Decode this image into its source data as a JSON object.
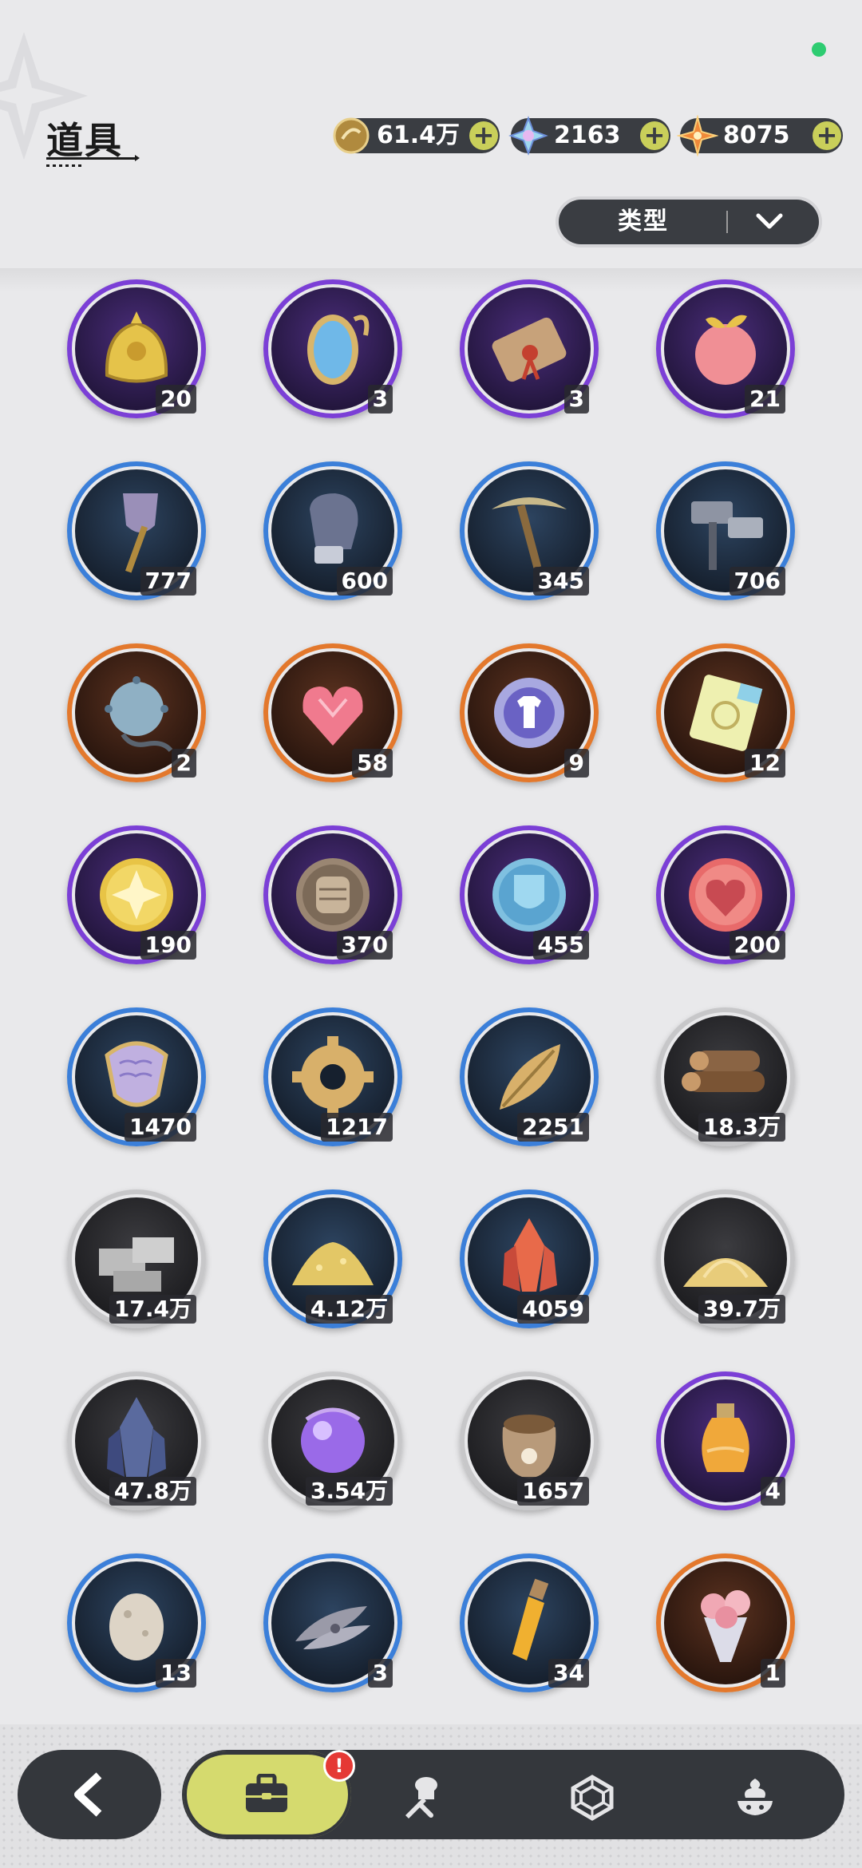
{
  "header": {
    "title": "道具"
  },
  "currencies": [
    {
      "name": "mora",
      "icon": "gold-coin-icon",
      "value": "61.4万"
    },
    {
      "name": "crystal",
      "icon": "crystal-icon",
      "value": "2163"
    },
    {
      "name": "star",
      "icon": "star-shard-icon",
      "value": "8075"
    }
  ],
  "filter": {
    "label": "类型"
  },
  "items": [
    {
      "icon": "golden-helmet-icon",
      "rarity": "purple",
      "count": "20"
    },
    {
      "icon": "magic-mirror-icon",
      "rarity": "purple",
      "count": "3"
    },
    {
      "icon": "scroll-icon",
      "rarity": "purple",
      "count": "3"
    },
    {
      "icon": "peach-icon",
      "rarity": "purple",
      "count": "21"
    },
    {
      "icon": "shovel-icon",
      "rarity": "blue",
      "count": "777"
    },
    {
      "icon": "gauntlet-icon",
      "rarity": "blue",
      "count": "600"
    },
    {
      "icon": "pickaxe-icon",
      "rarity": "blue",
      "count": "345"
    },
    {
      "icon": "hammer-icon",
      "rarity": "blue",
      "count": "706"
    },
    {
      "icon": "spiked-ball-icon",
      "rarity": "orange",
      "count": "2"
    },
    {
      "icon": "crystal-heart-icon",
      "rarity": "orange",
      "count": "58"
    },
    {
      "icon": "outfit-coin-icon",
      "rarity": "orange",
      "count": "9"
    },
    {
      "icon": "ticket-icon",
      "rarity": "orange",
      "count": "12"
    },
    {
      "icon": "flower-medal-icon",
      "rarity": "purple",
      "count": "190"
    },
    {
      "icon": "fist-medal-icon",
      "rarity": "purple",
      "count": "370"
    },
    {
      "icon": "shield-medal-icon",
      "rarity": "purple",
      "count": "455"
    },
    {
      "icon": "heart-medal-icon",
      "rarity": "purple",
      "count": "200"
    },
    {
      "icon": "scale-shield-icon",
      "rarity": "blue",
      "count": "1470"
    },
    {
      "icon": "gear-icon",
      "rarity": "blue",
      "count": "1217"
    },
    {
      "icon": "golden-leaf-icon",
      "rarity": "blue",
      "count": "2251"
    },
    {
      "icon": "wood-logs-icon",
      "rarity": "grey",
      "count": "18.3万"
    },
    {
      "icon": "stone-bricks-icon",
      "rarity": "grey",
      "count": "17.4万"
    },
    {
      "icon": "gold-dust-icon",
      "rarity": "blue",
      "count": "4.12万"
    },
    {
      "icon": "red-crystal-icon",
      "rarity": "blue",
      "count": "4059"
    },
    {
      "icon": "sand-pile-icon",
      "rarity": "grey",
      "count": "39.7万"
    },
    {
      "icon": "dark-crystal-icon",
      "rarity": "grey",
      "count": "47.8万"
    },
    {
      "icon": "purple-orb-icon",
      "rarity": "grey",
      "count": "3.54万"
    },
    {
      "icon": "seed-sack-icon",
      "rarity": "grey",
      "count": "1657"
    },
    {
      "icon": "potion-flask-icon",
      "rarity": "purple",
      "count": "4"
    },
    {
      "icon": "egg-icon",
      "rarity": "blue",
      "count": "13"
    },
    {
      "icon": "feathers-icon",
      "rarity": "blue",
      "count": "3"
    },
    {
      "icon": "vial-icon",
      "rarity": "blue",
      "count": "34"
    },
    {
      "icon": "bouquet-icon",
      "rarity": "orange",
      "count": "1"
    }
  ],
  "nav": {
    "back_icon": "back-arrow-icon",
    "tabs": [
      {
        "icon": "bag-icon",
        "active": true,
        "badge": "!"
      },
      {
        "icon": "chef-knife-icon",
        "active": false
      },
      {
        "icon": "hexagon-gem-icon",
        "active": false
      },
      {
        "icon": "dessert-icon",
        "active": false
      }
    ]
  },
  "colors": {
    "purple": "#7b3fd6",
    "blue": "#3b7fd9",
    "orange": "#e3782c",
    "grey": "#c7c7c9",
    "accent": "#d5da6e"
  }
}
